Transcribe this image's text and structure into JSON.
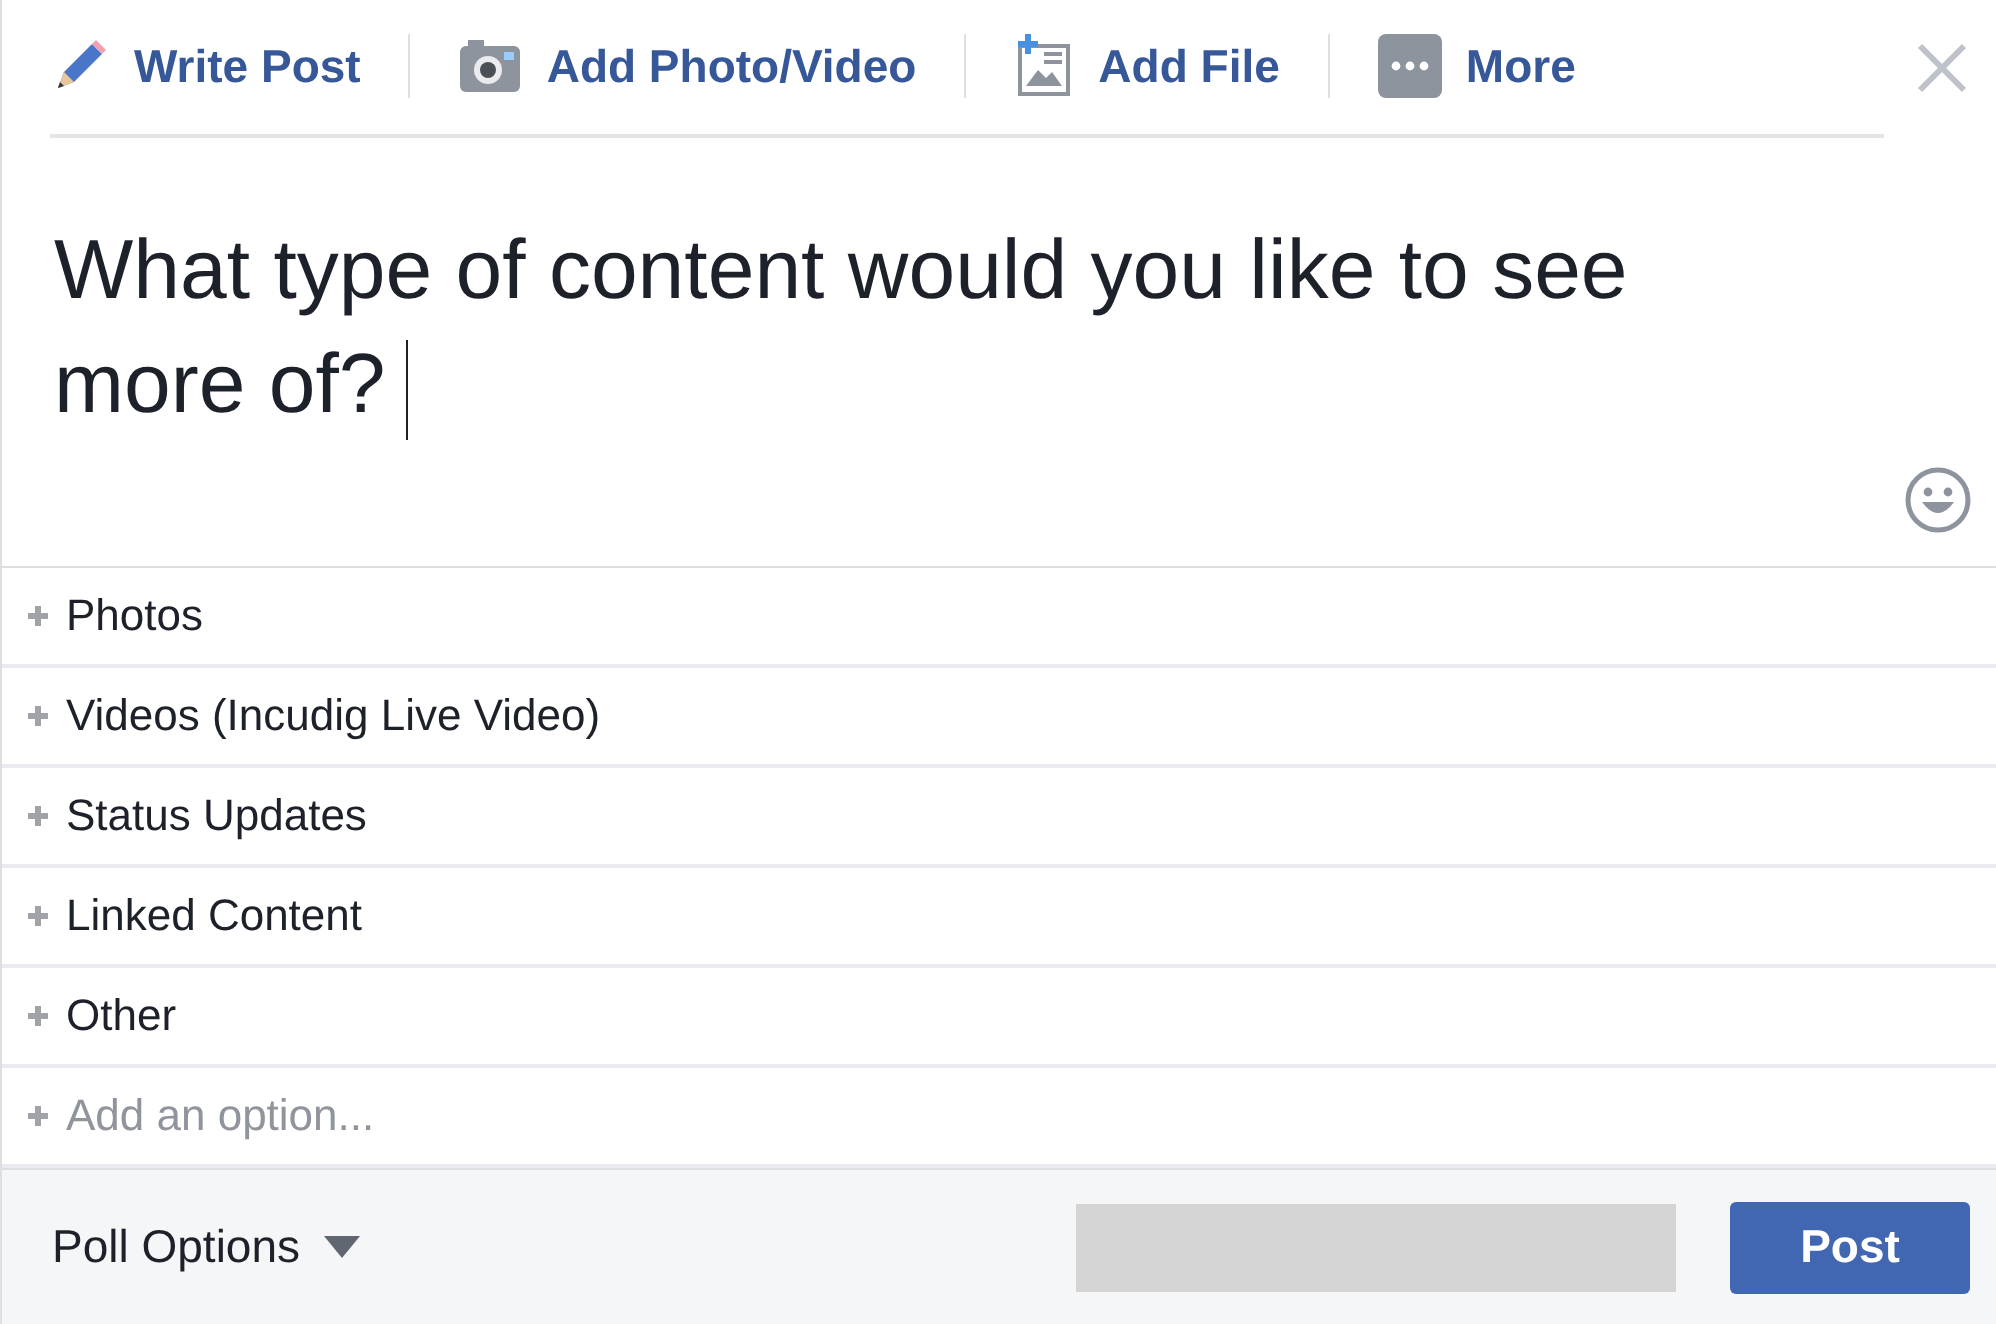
{
  "toolbar": [
    {
      "label": "Write Post",
      "kind": "pencil"
    },
    {
      "label": "Add Photo/Video",
      "kind": "camera"
    },
    {
      "label": "Add File",
      "kind": "file"
    },
    {
      "label": "More",
      "kind": "more"
    }
  ],
  "composer": {
    "value": "What type of content would you like to see more of?"
  },
  "options": [
    {
      "label": "Photos"
    },
    {
      "label": "Videos (Incudig Live Video)"
    },
    {
      "label": "Status Updates"
    },
    {
      "label": "Linked Content"
    },
    {
      "label": "Other"
    }
  ],
  "add_option": {
    "placeholder": "Add an option..."
  },
  "footer": {
    "poll_options": "Poll Options",
    "post_button": "Post"
  }
}
